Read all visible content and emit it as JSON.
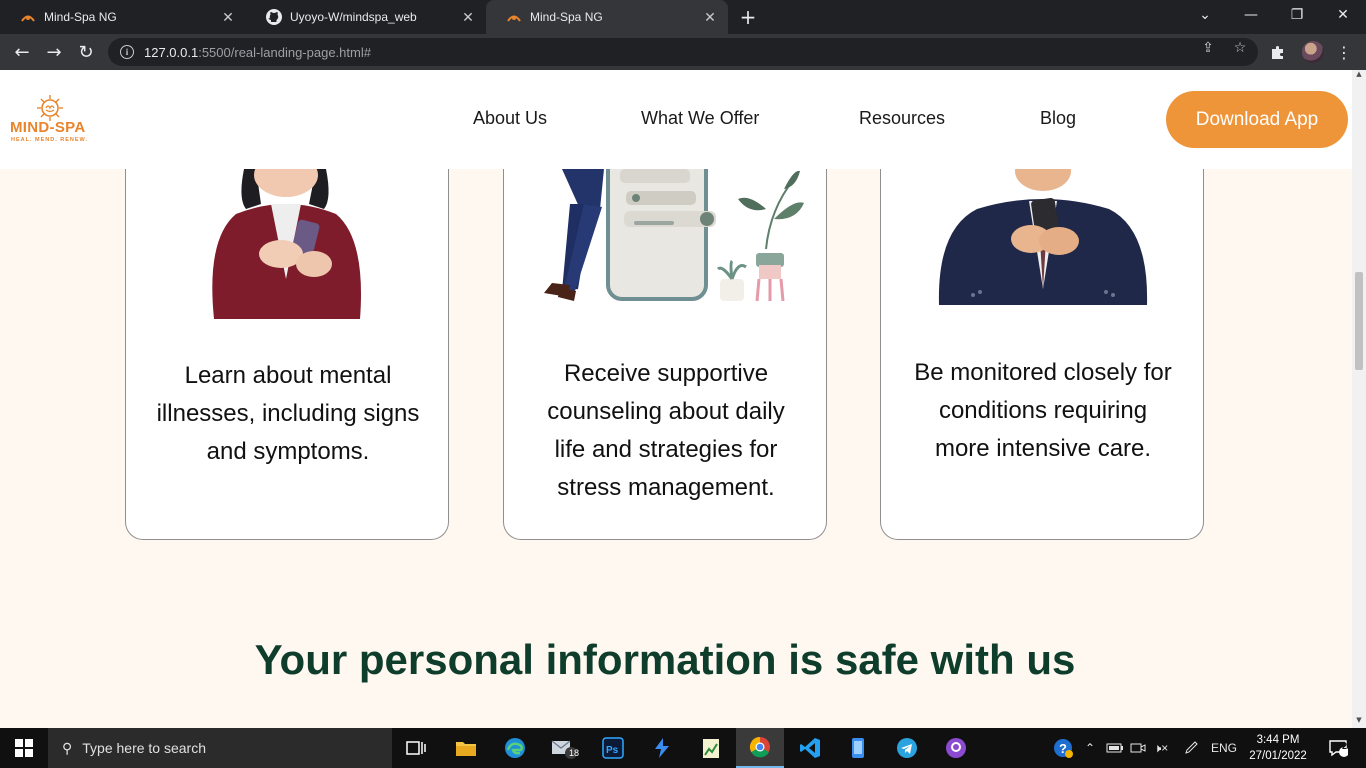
{
  "browser": {
    "tabs": [
      {
        "title": "Mind-Spa NG",
        "active": false
      },
      {
        "title": "Uyoyo-W/mindspa_web",
        "active": false
      },
      {
        "title": "Mind-Spa NG",
        "active": true
      }
    ],
    "new_tab": "+",
    "url_host": "127.0.0.1",
    "url_path": ":5500/real-landing-page.html#",
    "window_controls": {
      "dropdown": "⌄",
      "minimize": "—",
      "restore": "❐",
      "close": "✕"
    }
  },
  "site": {
    "logo": {
      "name": "MIND-SPA",
      "tagline": "HEAL. MEND. RENEW."
    },
    "nav": [
      "About Us",
      "What We Offer",
      "Resources",
      "Blog"
    ],
    "cta": "Download App",
    "cards": [
      {
        "text": "Learn about mental illnesses, including signs and symptoms.",
        "illustration": "woman-with-phone"
      },
      {
        "text": "Receive supportive counseling about daily life and strategies for stress management.",
        "illustration": "man-leaning-on-phone"
      },
      {
        "text": "Be monitored closely for conditions requiring more intensive care.",
        "illustration": "man-in-suit-with-phone"
      }
    ],
    "section_title": "Your personal information is safe with us",
    "colors": {
      "accent": "#ee9439",
      "heading": "#0f3d2c",
      "background": "#fff8f1"
    }
  },
  "taskbar": {
    "search_placeholder": "Type here to search",
    "mail_badge": "18",
    "language": "ENG",
    "time": "3:44 PM",
    "date": "27/01/2022",
    "notifications": "2"
  }
}
